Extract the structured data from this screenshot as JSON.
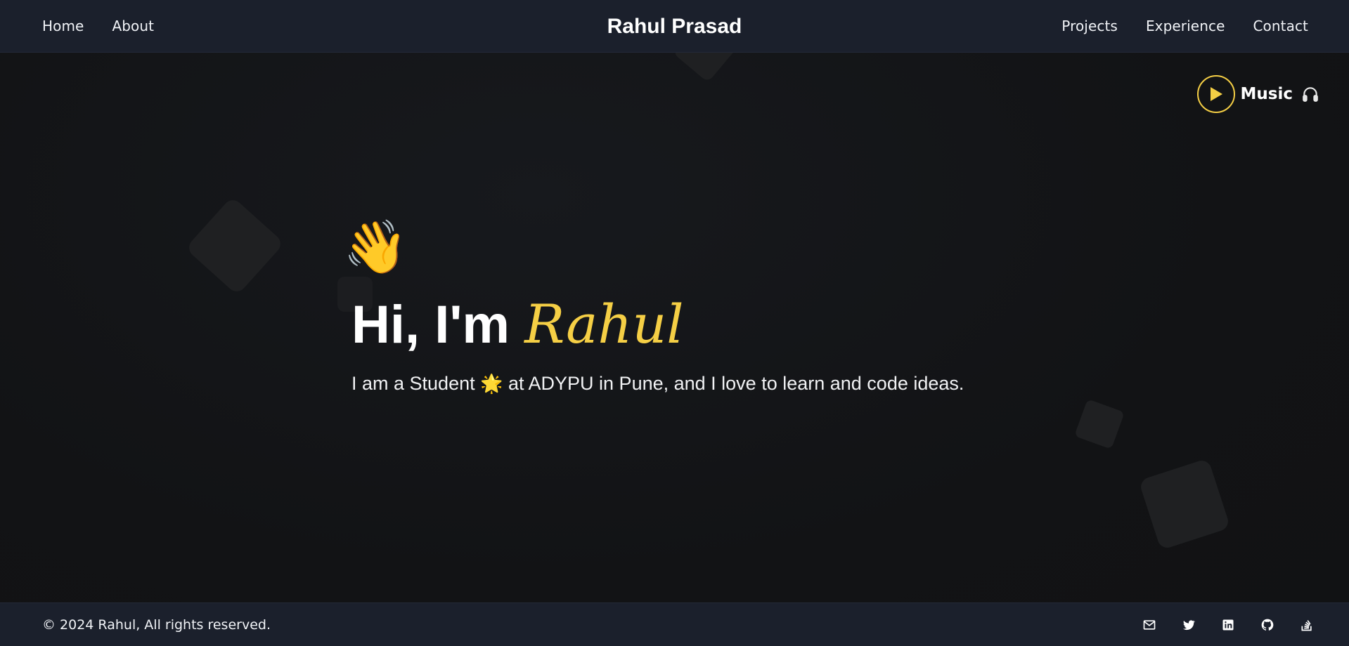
{
  "header": {
    "brand": "Rahul Prasad",
    "nav_left": [
      {
        "label": "Home"
      },
      {
        "label": "About"
      }
    ],
    "nav_right": [
      {
        "label": "Projects"
      },
      {
        "label": "Experience"
      },
      {
        "label": "Contact"
      }
    ]
  },
  "music": {
    "label": "Music",
    "icon": "play-icon",
    "trailing_icon": "headphones-icon",
    "accent_color": "#f5cf45"
  },
  "hero": {
    "wave_emoji": "👋",
    "greeting": "Hi, I'm ",
    "name": "Rahul",
    "subtitle_before": "I am a Student ",
    "subtitle_emoji": "🌟",
    "subtitle_after": " at ADYPU in Pune, and I love to learn and code ideas."
  },
  "footer": {
    "copyright": "© 2024 Rahul, All rights reserved.",
    "socials": [
      {
        "icon": "mail-icon"
      },
      {
        "icon": "twitter-icon"
      },
      {
        "icon": "linkedin-icon"
      },
      {
        "icon": "github-icon"
      },
      {
        "icon": "stackoverflow-icon"
      }
    ]
  },
  "colors": {
    "header_bg": "#1b202c",
    "page_bg": "#121316",
    "accent": "#f5cf45"
  }
}
